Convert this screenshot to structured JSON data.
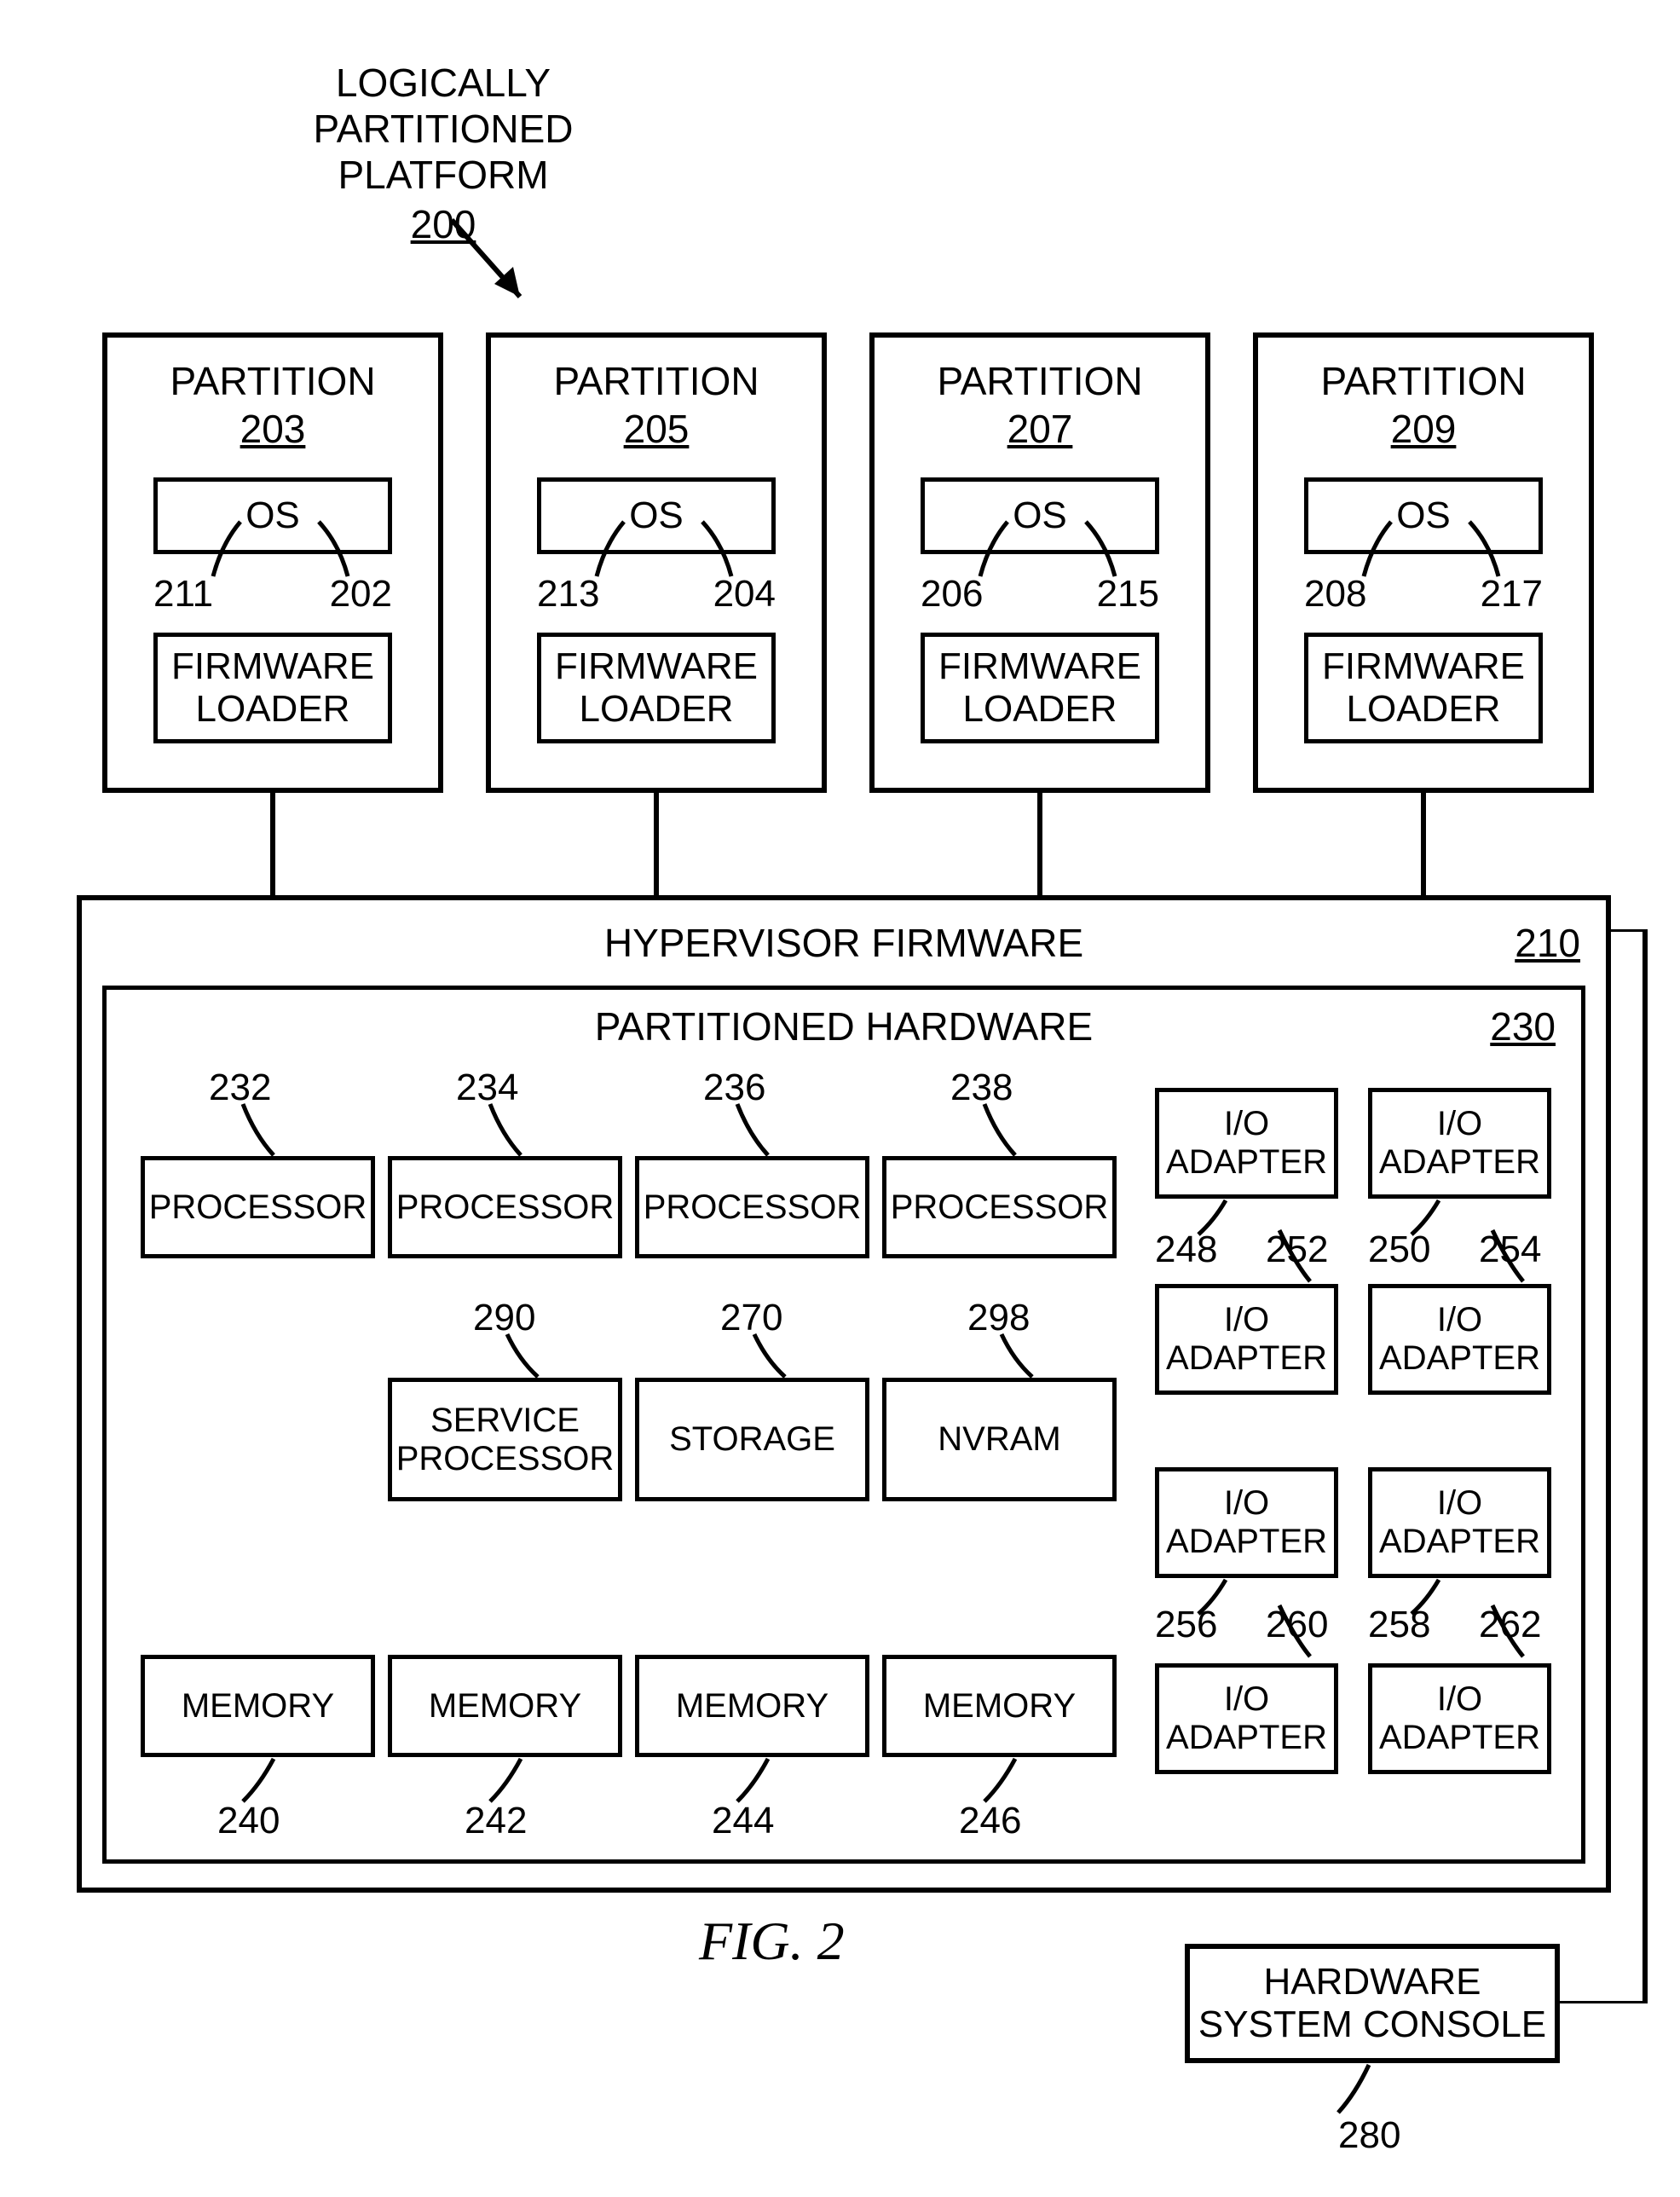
{
  "header": {
    "title_line1": "LOGICALLY PARTITIONED",
    "title_line2": "PLATFORM",
    "ref": "200"
  },
  "partitions": [
    {
      "title": "PARTITION",
      "ref": "203",
      "os": "OS",
      "os_left_ref": "211",
      "os_right_ref": "202",
      "fw_line1": "FIRMWARE",
      "fw_line2": "LOADER"
    },
    {
      "title": "PARTITION",
      "ref": "205",
      "os": "OS",
      "os_left_ref": "213",
      "os_right_ref": "204",
      "fw_line1": "FIRMWARE",
      "fw_line2": "LOADER"
    },
    {
      "title": "PARTITION",
      "ref": "207",
      "os": "OS",
      "os_left_ref": "206",
      "os_right_ref": "215",
      "fw_line1": "FIRMWARE",
      "fw_line2": "LOADER"
    },
    {
      "title": "PARTITION",
      "ref": "209",
      "os": "OS",
      "os_left_ref": "208",
      "os_right_ref": "217",
      "fw_line1": "FIRMWARE",
      "fw_line2": "LOADER"
    }
  ],
  "hypervisor": {
    "title": "HYPERVISOR FIRMWARE",
    "ref": "210"
  },
  "partitioned_hw": {
    "title": "PARTITIONED HARDWARE",
    "ref": "230"
  },
  "processors": [
    {
      "label": "PROCESSOR",
      "ref": "232"
    },
    {
      "label": "PROCESSOR",
      "ref": "234"
    },
    {
      "label": "PROCESSOR",
      "ref": "236"
    },
    {
      "label": "PROCESSOR",
      "ref": "238"
    }
  ],
  "midrow": [
    {
      "line1": "SERVICE",
      "line2": "PROCESSOR",
      "ref": "290"
    },
    {
      "line1": "STORAGE",
      "ref": "270"
    },
    {
      "line1": "NVRAM",
      "ref": "298"
    }
  ],
  "memories": [
    {
      "label": "MEMORY",
      "ref": "240"
    },
    {
      "label": "MEMORY",
      "ref": "242"
    },
    {
      "label": "MEMORY",
      "ref": "244"
    },
    {
      "label": "MEMORY",
      "ref": "246"
    }
  ],
  "io_adapters": {
    "label_line1": "I/O",
    "label_line2": "ADAPTER",
    "refs": {
      "r1l": "248",
      "r1r": "250",
      "r1rb": "254",
      "r1lb": "252",
      "r2l": "",
      "r3l": "256",
      "r3r": "258",
      "r3lb": "260",
      "r3rb": "262"
    }
  },
  "console": {
    "line1": "HARDWARE",
    "line2": "SYSTEM CONSOLE",
    "ref": "280"
  },
  "figure": "FIG. 2"
}
